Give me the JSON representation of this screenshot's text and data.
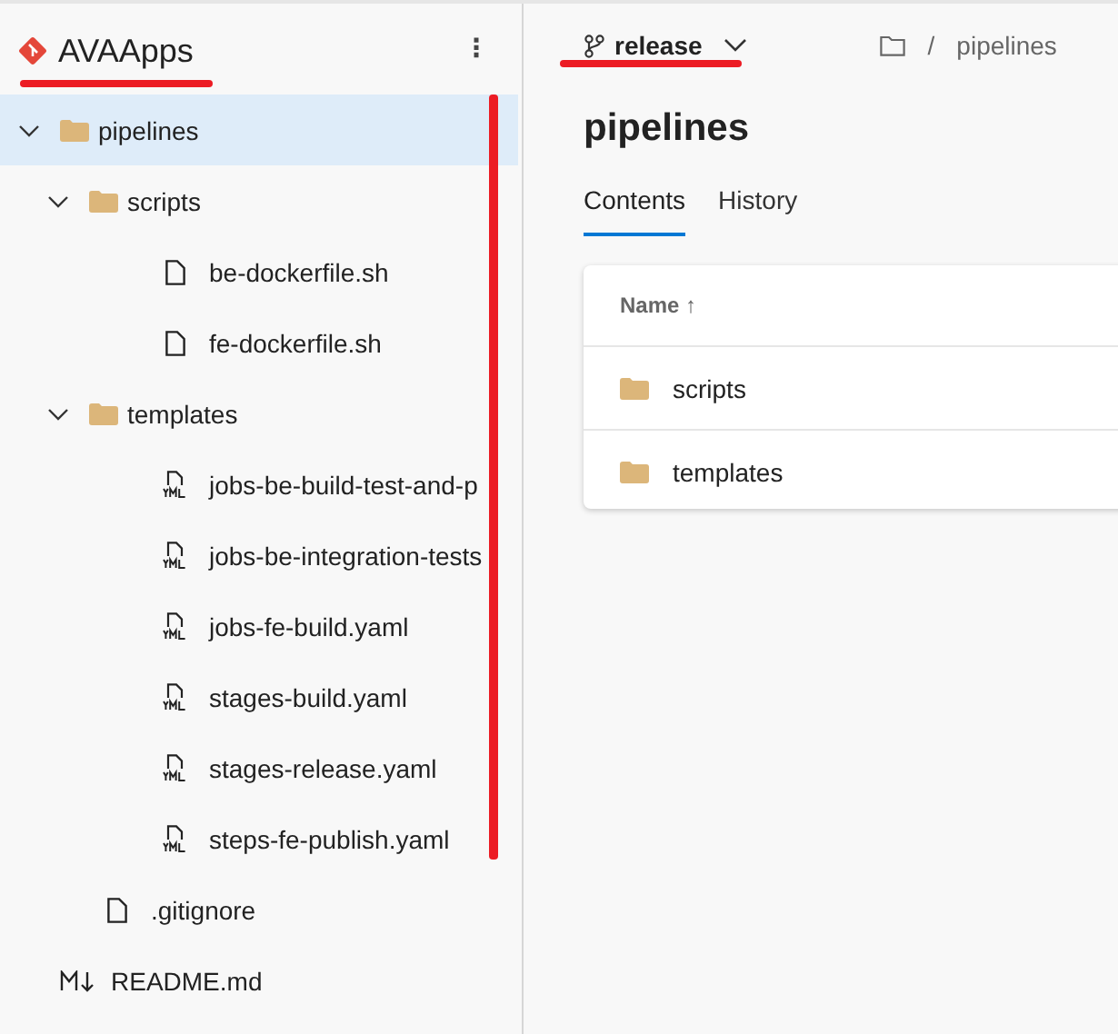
{
  "repo": {
    "name": "AVAApps",
    "menu": "⋮"
  },
  "tree": [
    {
      "name": "pipelines",
      "kind": "folder",
      "expanded": true,
      "selected": true,
      "children": [
        {
          "name": "scripts",
          "kind": "folder",
          "expanded": true,
          "selected": false,
          "children": [
            {
              "name": "be-dockerfile.sh",
              "kind": "file",
              "selected": false
            },
            {
              "name": "fe-dockerfile.sh",
              "kind": "file",
              "selected": false
            }
          ]
        },
        {
          "name": "templates",
          "kind": "folder",
          "expanded": true,
          "selected": false,
          "children": [
            {
              "name": "jobs-be-build-test-and-p",
              "kind": "yaml",
              "selected": false
            },
            {
              "name": "jobs-be-integration-tests",
              "kind": "yaml",
              "selected": false
            },
            {
              "name": "jobs-fe-build.yaml",
              "kind": "yaml",
              "selected": false
            },
            {
              "name": "stages-build.yaml",
              "kind": "yaml",
              "selected": false
            },
            {
              "name": "stages-release.yaml",
              "kind": "yaml",
              "selected": false
            },
            {
              "name": "steps-fe-publish.yaml",
              "kind": "yaml",
              "selected": false
            }
          ]
        }
      ]
    },
    {
      "name": ".gitignore",
      "kind": "file",
      "selected": false
    },
    {
      "name": "README.md",
      "kind": "markdown",
      "selected": false
    }
  ],
  "branch": {
    "name": "release"
  },
  "breadcrumb": {
    "separator": "/",
    "path": "pipelines"
  },
  "title": "pipelines",
  "tabs": [
    {
      "label": "Contents",
      "selected": true
    },
    {
      "label": "History",
      "selected": false
    }
  ],
  "table": {
    "column": "Name",
    "sort": "↑",
    "rows": [
      {
        "name": "scripts",
        "kind": "folder"
      },
      {
        "name": "templates",
        "kind": "folder"
      }
    ]
  },
  "annotations": {
    "repo_underline": true,
    "branch_underline": true,
    "tree_bar": true
  }
}
